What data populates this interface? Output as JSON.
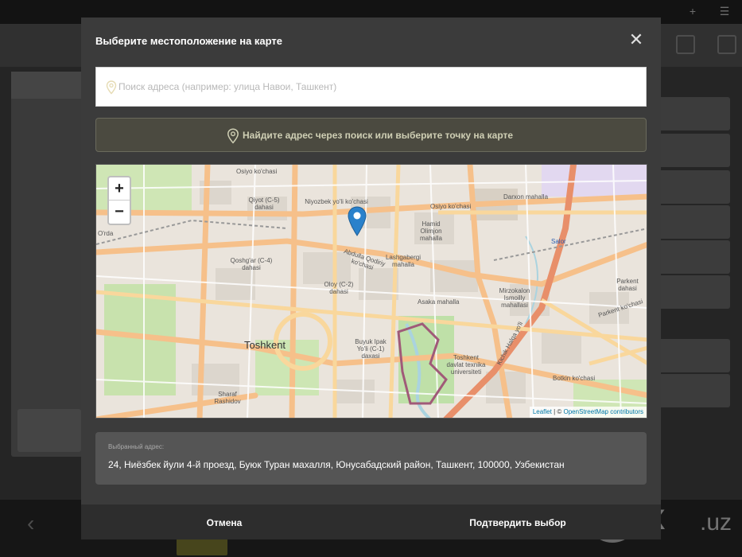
{
  "modal": {
    "title": "Выберите местоположение на карте",
    "close_icon": "close-icon",
    "search": {
      "placeholder": "Поиск адреса (например: улица Навои, Ташкент)",
      "value": "",
      "icon": "map-pin-icon"
    },
    "hint": {
      "icon": "map-pin-icon",
      "text": "Найдите адрес через поиск или выберите точку на карте"
    },
    "map": {
      "zoom_in": "+",
      "zoom_out": "−",
      "attribution_leaflet": "Leaflet",
      "attribution_sep": " | © ",
      "attribution_osm": "OpenStreetMap contributors",
      "labels": {
        "osiyo1": "Osiyo ko'chasi",
        "osiyo2": "Osiyo ko'chasi",
        "osiyo3": "Osiyo ko'chasi",
        "niyozbek": "Niyozbek yo'li ko'chasi",
        "qiyot": "Qiyot (C-5) dahasi",
        "darxon": "Darxon mahalla",
        "hamid": "Hamid Olimjon mahalla",
        "qoshgar": "Qoshg'ar (C-4) dahasi",
        "lashgabergi": "Lashgabergi mahalla",
        "abdulla": "Abdulla Qodiriy ko'chasi",
        "olay": "Oloy (C-2) dahasi",
        "asaka": "Asaka mahalla",
        "mirzokalon": "Mirzokalon Ismoilly mahallasi",
        "parkent": "Parkent dahasi",
        "parkent_st": "Parkent ko'chasi",
        "toshkent": "Toshkent",
        "buyuk": "Buyuk Ipak Yo'li (C-1) daxasi",
        "tgu": "Toshkent davlat texnika universiteti",
        "sharaf": "Sharaf Rashidov",
        "kichik": "Kichik Halqa yo'li",
        "botkin": "Botkin ko'chasi",
        "salor": "Salor",
        "orda": "O'rda"
      }
    },
    "selected_address": {
      "label": "Выбранный адрес:",
      "value": "24, Ниёзбек йули 4-й проезд, Буюк Туран махалля, Юнусабадский район, Ташкент, 100000, Узбекистан"
    },
    "buttons": {
      "cancel": "Отмена",
      "confirm": "Подтвердить выбор"
    }
  },
  "watermark": {
    "brand": "lx",
    "tld": ".uz"
  },
  "colors": {
    "modal_bg": "#3b3b3b",
    "hint_text": "#cfcfb4",
    "marker": "#2a81cb"
  }
}
